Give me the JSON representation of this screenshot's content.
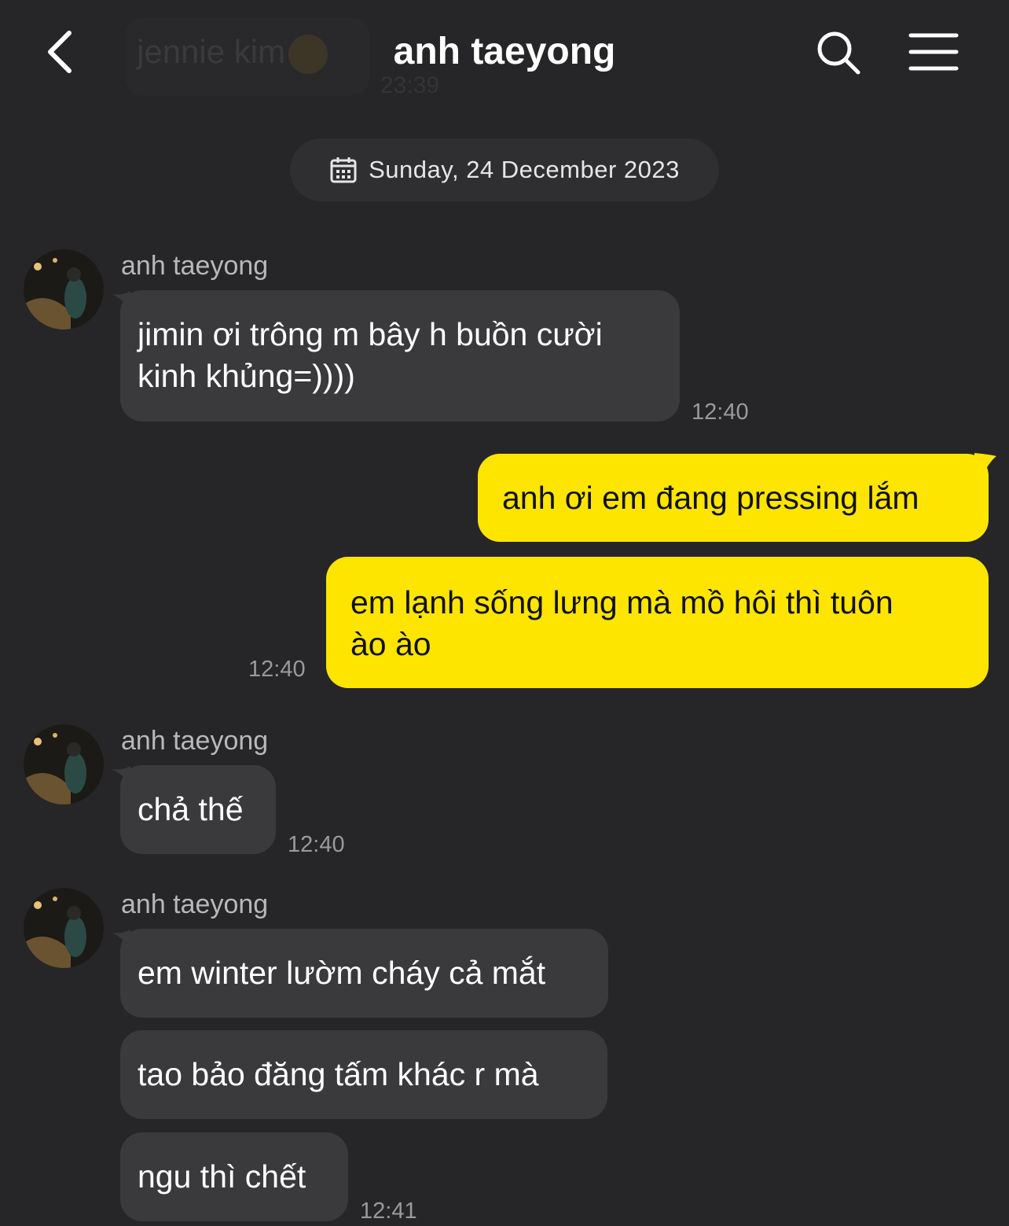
{
  "header": {
    "title": "anh taeyong",
    "ghost_preview": {
      "name": "jennie kim",
      "time": "23:39"
    }
  },
  "date_divider": "Sunday, 24 December 2023",
  "messages": [
    {
      "sender": "anh taeyong",
      "lines": [
        "jimin ơi trông m bây h buồn cười",
        "kinh khủng=))))"
      ],
      "time": "12:40"
    },
    {
      "lines": [
        "anh ơi em đang pressing lắm"
      ]
    },
    {
      "lines": [
        "em lạnh sống lưng mà mồ hôi thì tuôn",
        "ào ào"
      ],
      "time": "12:40"
    },
    {
      "sender": "anh taeyong",
      "lines": [
        "chả thế"
      ],
      "time": "12:40"
    },
    {
      "sender": "anh taeyong",
      "lines": [
        "em winter lườm cháy cả mắt"
      ]
    },
    {
      "lines": [
        "tao bảo đăng tấm khác r mà"
      ]
    },
    {
      "lines": [
        "ngu thì chết"
      ],
      "time": "12:41"
    }
  ],
  "colors": {
    "background": "#262628",
    "incoming_bubble": "#3a3a3c",
    "outgoing_bubble": "#fee500"
  },
  "icons": [
    "back-arrow",
    "search",
    "menu",
    "calendar"
  ]
}
